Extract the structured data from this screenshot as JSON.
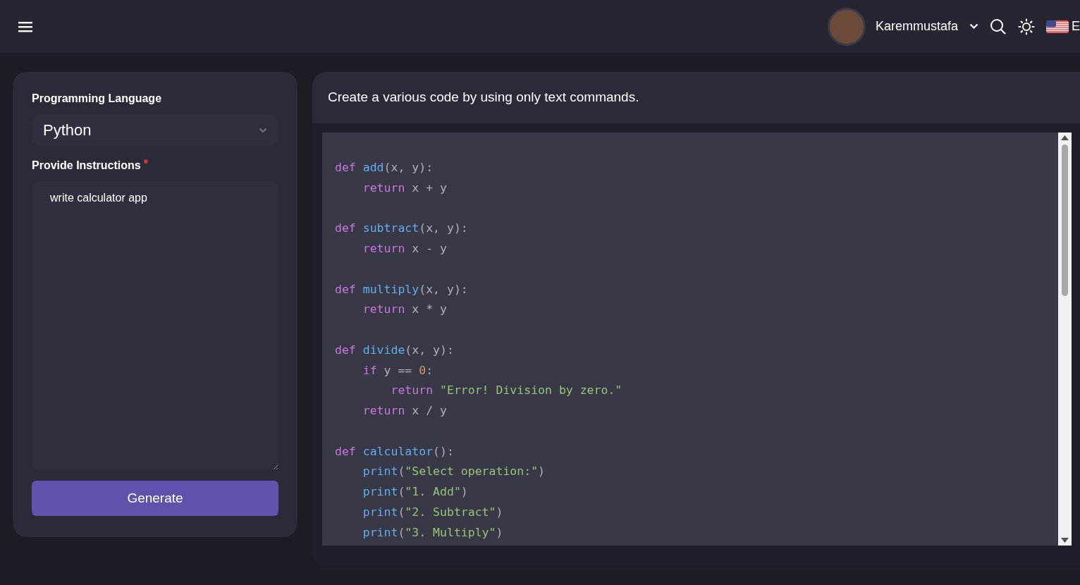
{
  "navbar": {
    "user_name": "Karemmustafa",
    "language": "E"
  },
  "form": {
    "language_label": "Programming Language",
    "language_value": "Python",
    "instructions_label": "Provide Instructions",
    "required": true,
    "instructions_value": "write calculator app",
    "generate_button": "Generate"
  },
  "output": {
    "heading": "Create a various code by using only text commands.",
    "code_lines": [
      {
        "kind": "code",
        "tokens": [
          {
            "kind": "keyword",
            "text": "def"
          },
          {
            "kind": "function",
            "text": " add"
          },
          {
            "kind": "plain",
            "text": "(x, y):"
          }
        ]
      },
      {
        "kind": "code",
        "tokens": [
          {
            "kind": "keyword",
            "text": "    return"
          },
          {
            "kind": "plain",
            "text": " x + y"
          }
        ]
      },
      {
        "kind": "blank"
      },
      {
        "kind": "code",
        "tokens": [
          {
            "kind": "keyword",
            "text": "def"
          },
          {
            "kind": "function",
            "text": " subtract"
          },
          {
            "kind": "plain",
            "text": "(x, y):"
          }
        ]
      },
      {
        "kind": "code",
        "tokens": [
          {
            "kind": "keyword",
            "text": "    return"
          },
          {
            "kind": "plain",
            "text": " x - y"
          }
        ]
      },
      {
        "kind": "blank"
      },
      {
        "kind": "code",
        "tokens": [
          {
            "kind": "keyword",
            "text": "def"
          },
          {
            "kind": "function",
            "text": " multiply"
          },
          {
            "kind": "plain",
            "text": "(x, y):"
          }
        ]
      },
      {
        "kind": "code",
        "tokens": [
          {
            "kind": "keyword",
            "text": "    return"
          },
          {
            "kind": "plain",
            "text": " x * y"
          }
        ]
      },
      {
        "kind": "blank"
      },
      {
        "kind": "code",
        "tokens": [
          {
            "kind": "keyword",
            "text": "def"
          },
          {
            "kind": "function",
            "text": " divide"
          },
          {
            "kind": "plain",
            "text": "(x, y):"
          }
        ]
      },
      {
        "kind": "code",
        "tokens": [
          {
            "kind": "keyword",
            "text": "    if"
          },
          {
            "kind": "plain",
            "text": " y == "
          },
          {
            "kind": "number",
            "text": "0"
          },
          {
            "kind": "plain",
            "text": ":"
          }
        ]
      },
      {
        "kind": "code",
        "tokens": [
          {
            "kind": "keyword",
            "text": "        return"
          },
          {
            "kind": "string",
            "text": " \"Error! Division by zero.\""
          }
        ]
      },
      {
        "kind": "code",
        "tokens": [
          {
            "kind": "keyword",
            "text": "    return"
          },
          {
            "kind": "plain",
            "text": " x / y"
          }
        ]
      },
      {
        "kind": "blank"
      },
      {
        "kind": "code",
        "tokens": [
          {
            "kind": "keyword",
            "text": "def"
          },
          {
            "kind": "function",
            "text": " calculator"
          },
          {
            "kind": "plain",
            "text": "():"
          }
        ]
      },
      {
        "kind": "code",
        "tokens": [
          {
            "kind": "function",
            "text": "    print"
          },
          {
            "kind": "plain",
            "text": "("
          },
          {
            "kind": "string",
            "text": "\"Select operation:\""
          },
          {
            "kind": "plain",
            "text": ")"
          }
        ]
      },
      {
        "kind": "code",
        "tokens": [
          {
            "kind": "function",
            "text": "    print"
          },
          {
            "kind": "plain",
            "text": "("
          },
          {
            "kind": "string",
            "text": "\"1. Add\""
          },
          {
            "kind": "plain",
            "text": ")"
          }
        ]
      },
      {
        "kind": "code",
        "tokens": [
          {
            "kind": "function",
            "text": "    print"
          },
          {
            "kind": "plain",
            "text": "("
          },
          {
            "kind": "string",
            "text": "\"2. Subtract\""
          },
          {
            "kind": "plain",
            "text": ")"
          }
        ]
      },
      {
        "kind": "code",
        "tokens": [
          {
            "kind": "function",
            "text": "    print"
          },
          {
            "kind": "plain",
            "text": "("
          },
          {
            "kind": "string",
            "text": "\"3. Multiply\""
          },
          {
            "kind": "plain",
            "text": ")"
          }
        ]
      }
    ]
  }
}
